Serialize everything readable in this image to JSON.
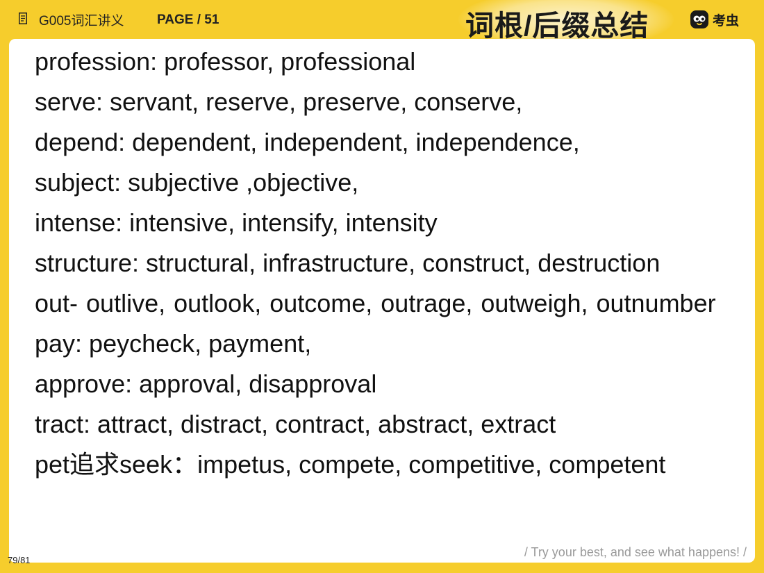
{
  "header": {
    "course_title": "G005词汇讲义",
    "page_label": "PAGE / 51",
    "slide_title": "词根/后缀总结",
    "logo_text": "考虫",
    "icons": {
      "document": "document-icon",
      "logo": "kaochong-logo-icon"
    }
  },
  "content": {
    "items": [
      "profession: professor, professional",
      "serve: servant, reserve, preserve, conserve,",
      "depend: dependent, independent, independence,",
      "subject: subjective ,objective,",
      "intense: intensive, intensify, intensity",
      "structure: structural, infrastructure, construct, destruction",
      "out- outlive, outlook, outcome, outrage, outweigh, outnumber",
      "pay: peycheck, payment,",
      "approve: approval, disapproval",
      "tract: attract, distract, contract, abstract, extract",
      "pet追求seek：impetus, compete, competitive, competent"
    ]
  },
  "footer": {
    "motto": "/ Try your best, and see what happens! /",
    "slide_number": "79/81"
  },
  "colors": {
    "background": "#f6cd2c",
    "card": "#ffffff",
    "text": "#111111",
    "motto": "#9a9a9a"
  }
}
